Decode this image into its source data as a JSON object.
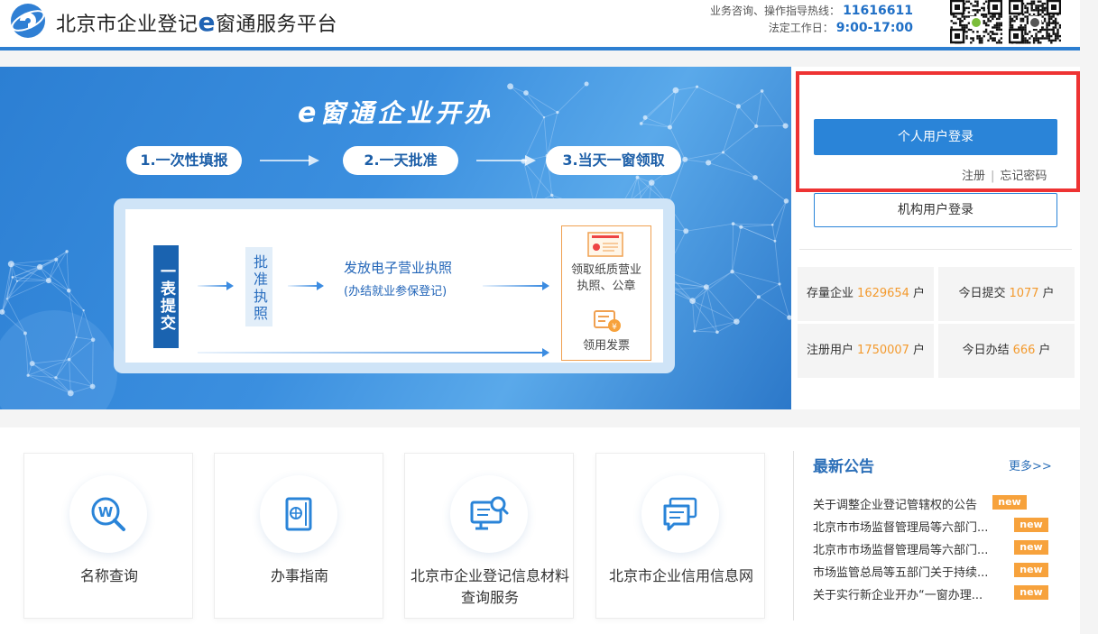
{
  "header": {
    "title_prefix": "北京市企业登记",
    "title_e": "e",
    "title_suffix": "窗通服务平台",
    "hotline_label": "业务咨询、操作指导热线：",
    "hotline_number": "11616611",
    "hours_label": "法定工作日：",
    "hours_value": "9:00-17:00",
    "colors": {
      "accent": "#2d7fd1",
      "title_e": "#1f63b4"
    },
    "icons": [
      "globe-logo-icon",
      "qr-android-icon",
      "qr-apple-icon"
    ]
  },
  "banner": {
    "title_e": "e",
    "title": "窗通企业开办",
    "steps": [
      "1.一次性填报",
      "2.一天批准",
      "3.当天一窗领取"
    ],
    "flow": {
      "submit": "一表提交",
      "approve": "批准执照",
      "issue_title": "发放电子营业执照",
      "issue_sub": "(办结就业参保登记)",
      "pickup": [
        "领取纸质营业",
        "执照、公章"
      ],
      "invoice": "领用发票"
    }
  },
  "login": {
    "personal_button": "个人用户登录",
    "register_link": "注册",
    "separator": "|",
    "forgot_link": "忘记密码",
    "org_button": "机构用户登录",
    "highlight_color": "#ee3333"
  },
  "stats": [
    {
      "label": "存量企业",
      "value": "1629654",
      "unit": "户"
    },
    {
      "label": "今日提交",
      "value": "1077",
      "unit": "户"
    },
    {
      "label": "注册用户",
      "value": "1750007",
      "unit": "户"
    },
    {
      "label": "今日办结",
      "value": "666",
      "unit": "户"
    }
  ],
  "services": [
    {
      "label": "名称查询",
      "icon": "name-search-icon"
    },
    {
      "label": "办事指南",
      "icon": "guide-book-icon"
    },
    {
      "label": "北京市企业登记信息材料查询服务",
      "icon": "info-query-icon"
    },
    {
      "label": "北京市企业信用信息网",
      "icon": "credit-chat-icon"
    }
  ],
  "notices": {
    "title": "最新公告",
    "more": "更多>>",
    "badge": "new",
    "items": [
      "关于调整企业登记管辖权的公告",
      "北京市市场监督管理局等六部门...",
      "北京市市场监督管理局等六部门...",
      "市场监管总局等五部门关于持续...",
      "关于实行新企业开办“一窗办理..."
    ]
  }
}
